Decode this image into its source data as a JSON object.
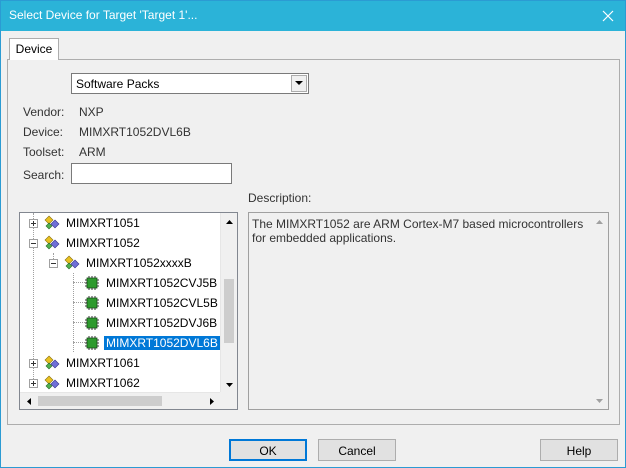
{
  "window": {
    "title": "Select Device for Target 'Target 1'..."
  },
  "tabs": [
    {
      "label": "Device"
    }
  ],
  "source_select": {
    "value": "Software Packs"
  },
  "info": {
    "vendor_label": "Vendor:",
    "vendor_value": "NXP",
    "device_label": "Device:",
    "device_value": "MIMXRT1052DVL6B",
    "toolset_label": "Toolset:",
    "toolset_value": "ARM",
    "search_label": "Search:",
    "search_value": ""
  },
  "tree": {
    "nodes": [
      {
        "label": "MIMXRT1051",
        "state": "collapsed"
      },
      {
        "label": "MIMXRT1052",
        "state": "expanded"
      },
      {
        "label": "MIMXRT1052xxxxB",
        "state": "expanded"
      },
      {
        "label": "MIMXRT1052CVJ5B"
      },
      {
        "label": "MIMXRT1052CVL5B"
      },
      {
        "label": "MIMXRT1052DVJ6B"
      },
      {
        "label": "MIMXRT1052DVL6B",
        "selected": true
      },
      {
        "label": "MIMXRT1061",
        "state": "collapsed"
      },
      {
        "label": "MIMXRT1062",
        "state": "collapsed"
      }
    ]
  },
  "description": {
    "label": "Description:",
    "text": "The MIMXRT1052 are ARM Cortex-M7 based microcontrollers for embedded applications."
  },
  "buttons": {
    "ok": "OK",
    "cancel": "Cancel",
    "help": "Help"
  },
  "colors": {
    "titlebar": "#2bb3d8",
    "selection": "#0078d7"
  },
  "icons": {
    "group": "diamond-group-icon",
    "chip": "chip-icon",
    "close": "close-icon"
  }
}
